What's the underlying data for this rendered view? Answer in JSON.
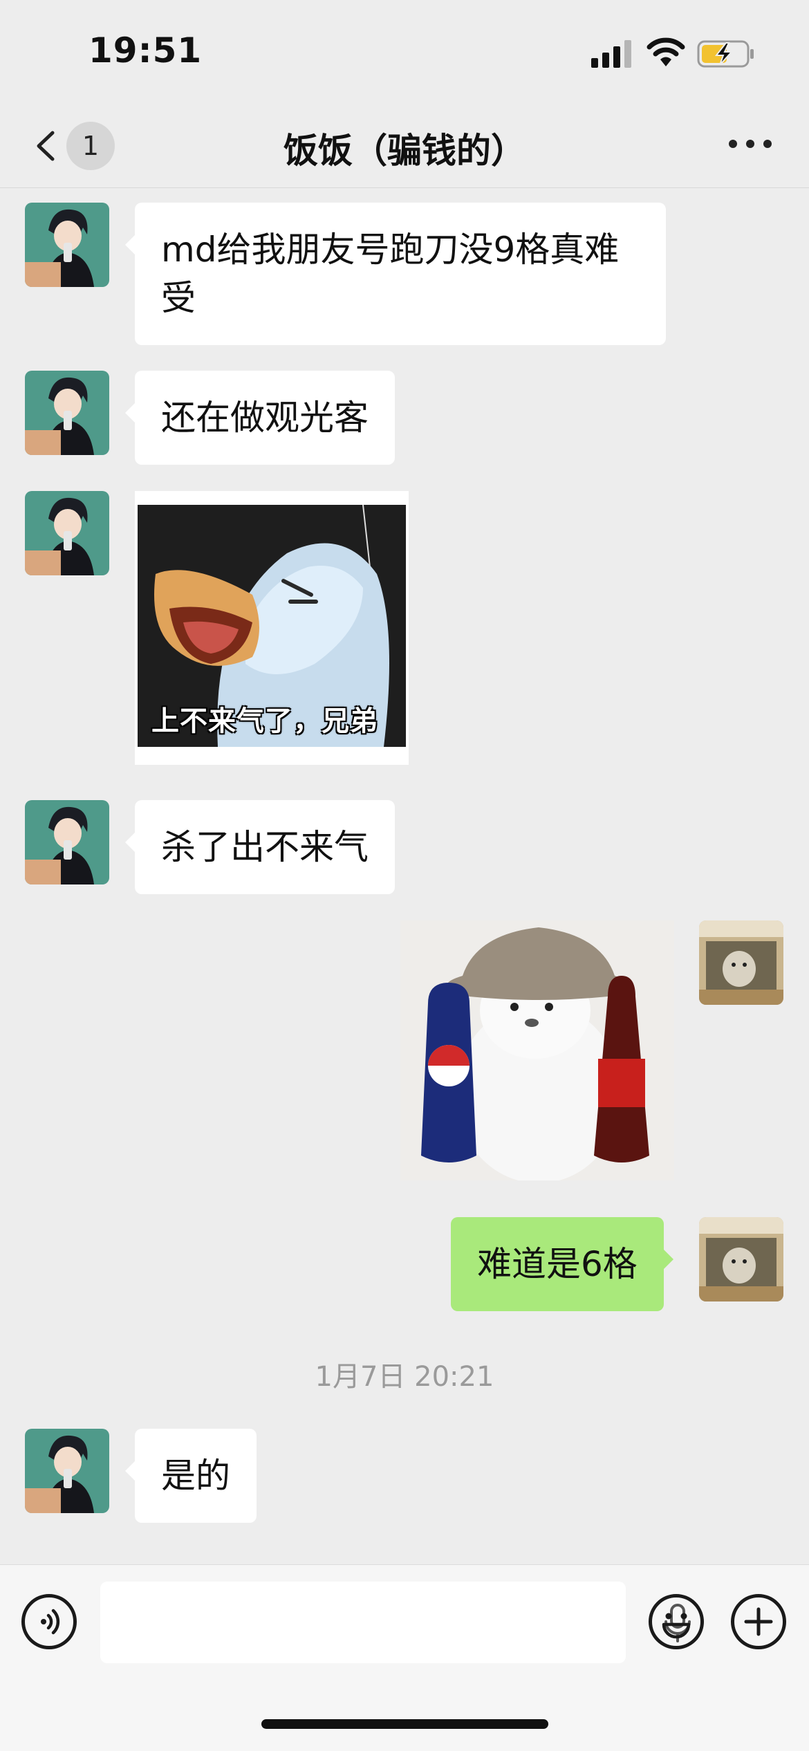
{
  "status_bar": {
    "time": "19:51"
  },
  "header": {
    "back_badge": "1",
    "title": "饭饭（骗钱的）"
  },
  "messages": [
    {
      "side": "left",
      "type": "text",
      "text": "md给我朋友号跑刀没9格真难受"
    },
    {
      "side": "left",
      "type": "text",
      "text": "还在做观光客"
    },
    {
      "side": "left",
      "type": "sticker",
      "caption": "上不来气了，兄弟"
    },
    {
      "side": "left",
      "type": "text",
      "text": "杀了出不来气"
    },
    {
      "side": "right",
      "type": "sticker",
      "description": "cat-with-cola-sticker"
    },
    {
      "side": "right",
      "type": "text",
      "text": "难道是6格"
    },
    {
      "type": "timestamp",
      "text": "1月7日 20:21"
    },
    {
      "side": "left",
      "type": "text",
      "text": "是的"
    }
  ],
  "icons": {
    "back": "chevron-left-icon",
    "more": "more-dots-icon",
    "voice": "voice-mode-icon",
    "mic": "microphone-icon",
    "emoji": "emoji-icon",
    "add": "plus-icon"
  },
  "colors": {
    "background": "#ededed",
    "bubble_incoming": "#ffffff",
    "bubble_outgoing": "#a9e97b"
  }
}
